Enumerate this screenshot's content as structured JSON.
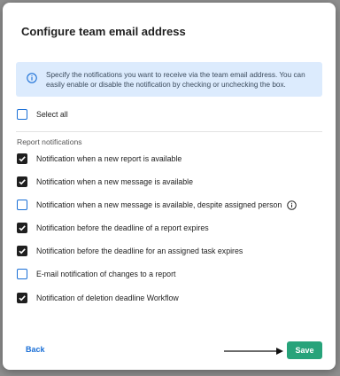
{
  "dialog": {
    "title": "Configure team email address",
    "info_text": "Specify the notifications you want to receive via the team email address. You can easily enable or disable the notification by checking or unchecking the box.",
    "select_all": {
      "label": "Select all",
      "checked": false
    },
    "section_title": "Report notifications",
    "notifications": [
      {
        "label": "Notification when a new report is available",
        "checked": true
      },
      {
        "label": "Notification when a new message is available",
        "checked": true
      },
      {
        "label": "Notification when a new message is available, despite assigned person",
        "checked": false,
        "has_info_icon": true
      },
      {
        "label": "Notification before the deadline of a report expires",
        "checked": true
      },
      {
        "label": "Notification before the deadline for an assigned task expires",
        "checked": true
      },
      {
        "label": "E-mail notification of changes to a report",
        "checked": false
      },
      {
        "label": "Notification of deletion deadline Workflow",
        "checked": true
      }
    ],
    "back_label": "Back",
    "save_label": "Save"
  },
  "colors": {
    "info_bg": "#dcebfd",
    "accent_blue": "#1a6fd6",
    "save_green": "#27a37a",
    "checked_fill": "#1f1f1f"
  },
  "icons": {
    "info": "info-circle-icon",
    "check": "checkmark-icon",
    "arrow": "arrow-right-icon"
  }
}
